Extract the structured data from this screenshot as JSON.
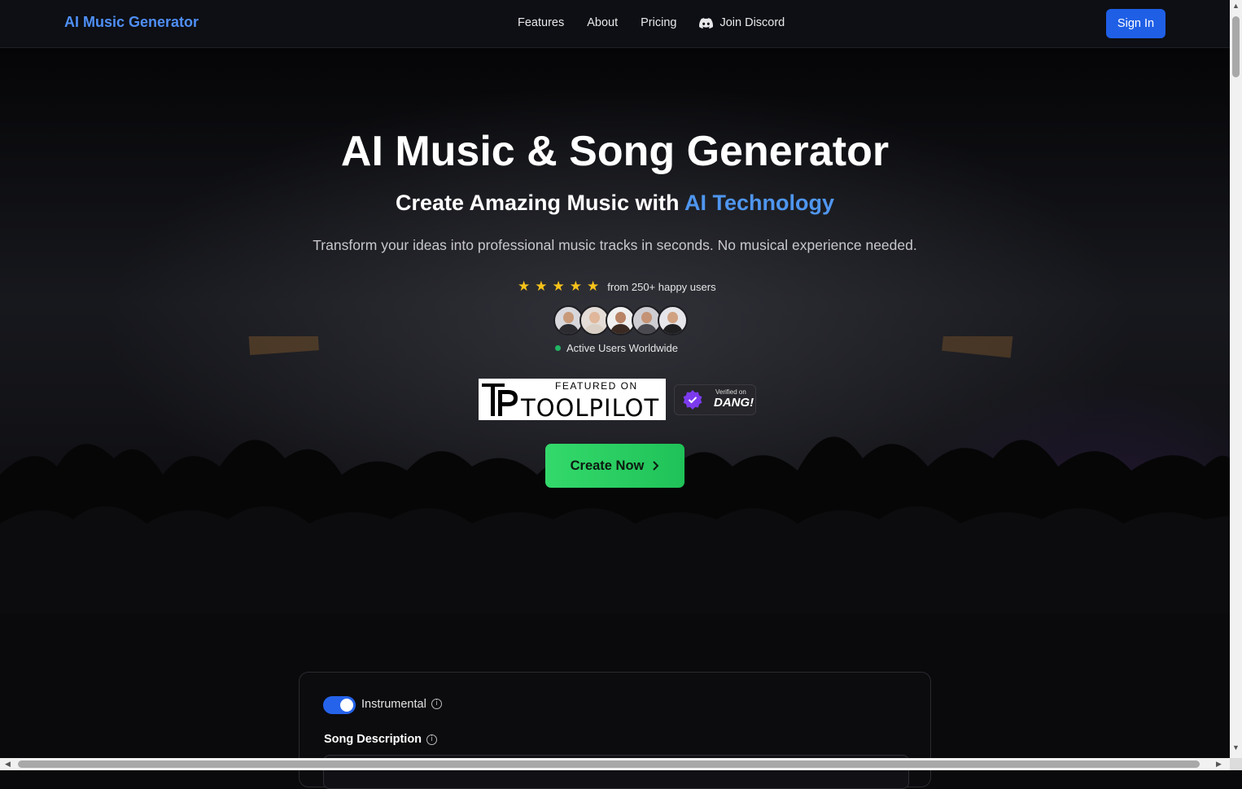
{
  "nav": {
    "brand": "AI Music Generator",
    "links": [
      "Features",
      "About",
      "Pricing"
    ],
    "discord_label": "Join Discord",
    "signin_label": "Sign In"
  },
  "hero": {
    "title": "AI Music & Song Generator",
    "subtitle_plain": "Create Amazing Music with ",
    "subtitle_accent": "AI Technology",
    "description": "Transform your ideas into professional music tracks in seconds. No musical experience needed.",
    "rating_stars": 5,
    "rating_text": "from 250+ happy users",
    "active_users_text": "Active Users Worldwide",
    "cta_label": "Create Now",
    "accent_color": "#4f96f0",
    "cta_color": "#22c55e"
  },
  "badges": {
    "toolpilot_featured": "FEATURED ON",
    "toolpilot_name": "TOOLPILOT",
    "dang_verified": "Verified on",
    "dang_name": "DANG!"
  },
  "form": {
    "instrumental_label": "Instrumental",
    "instrumental_on": true,
    "song_description_label": "Song Description"
  }
}
